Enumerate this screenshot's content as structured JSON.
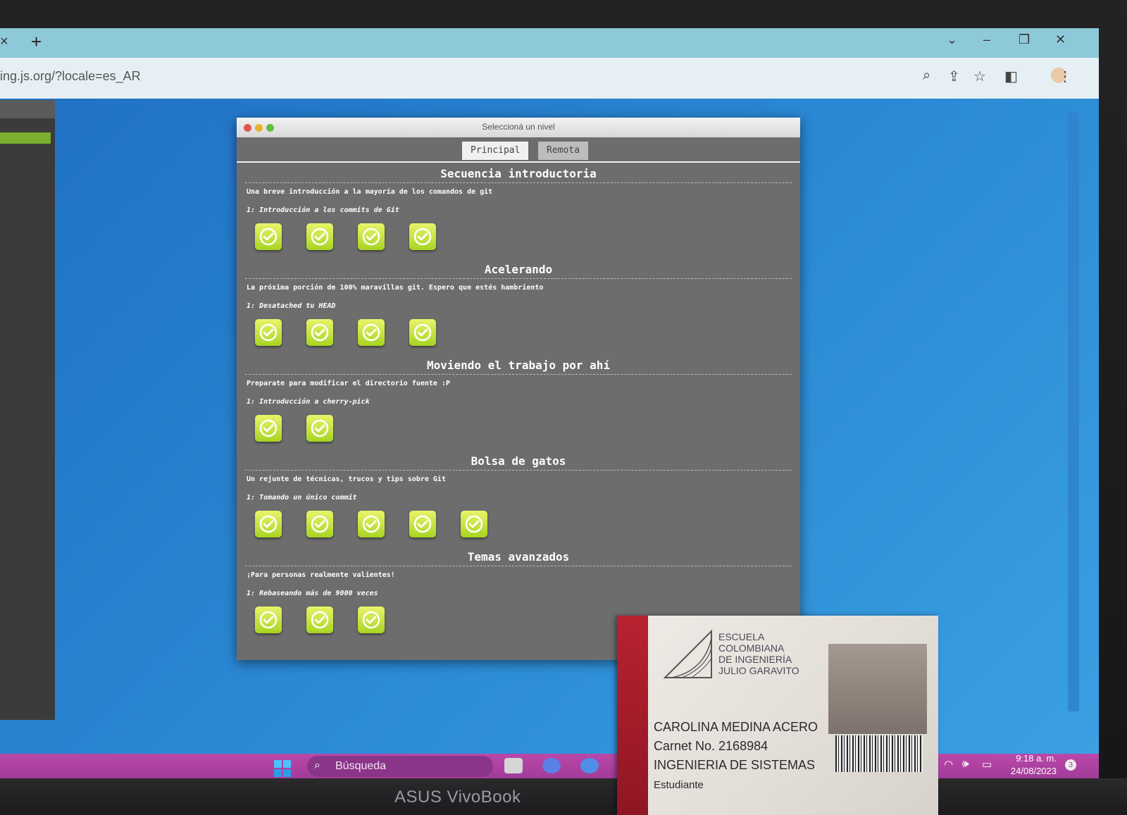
{
  "browser": {
    "new_tab": "+",
    "tab_close": "×",
    "url": "ing.js.org/?locale=es_AR"
  },
  "dialog": {
    "title": "Seleccioná un nivel",
    "tabs": [
      {
        "label": "Principal",
        "active": true
      },
      {
        "label": "Remota",
        "active": false
      }
    ],
    "sections": [
      {
        "title": "Secuencia introductoria",
        "description": "Una breve introducción a la mayoría de los comandos de git",
        "level_label": "1: Introducción a los commits de Git",
        "completed_levels": 4
      },
      {
        "title": "Acelerando",
        "description": "La próxima porción de 100% maravillas git. Espero que estés hambriento",
        "level_label": "1: Desatached tu HEAD",
        "completed_levels": 4
      },
      {
        "title": "Moviendo el trabajo por ahí",
        "description": "Preparate para modificar el directorio fuente :P",
        "level_label": "1: Introducción a cherry-pick",
        "completed_levels": 2
      },
      {
        "title": "Bolsa de gatos",
        "description": "Un rejunte de técnicas, trucos y tips sobre Git",
        "level_label": "1: Tomando un único commit",
        "completed_levels": 5
      },
      {
        "title": "Temas avanzados",
        "description": "¡Para personas realmente valientes!",
        "level_label": "1: Rebaseando más de 9000 veces",
        "completed_levels": 3
      }
    ],
    "level_color": "#c4e33a"
  },
  "taskbar": {
    "search_placeholder": "Búsqueda",
    "time": "9:18 a. m.",
    "date": "24/08/2023",
    "notification_count": "3"
  },
  "id_card": {
    "school_lines": [
      "ESCUELA",
      "COLOMBIANA",
      "DE INGENIERÍA",
      "JULIO GARAVITO"
    ],
    "name": "CAROLINA MEDINA ACERO",
    "carnet": "Carnet No. 2168984",
    "program": "INGENIERIA DE SISTEMAS",
    "role": "Estudiante"
  },
  "laptop_brand": "ASUS VivoBook"
}
